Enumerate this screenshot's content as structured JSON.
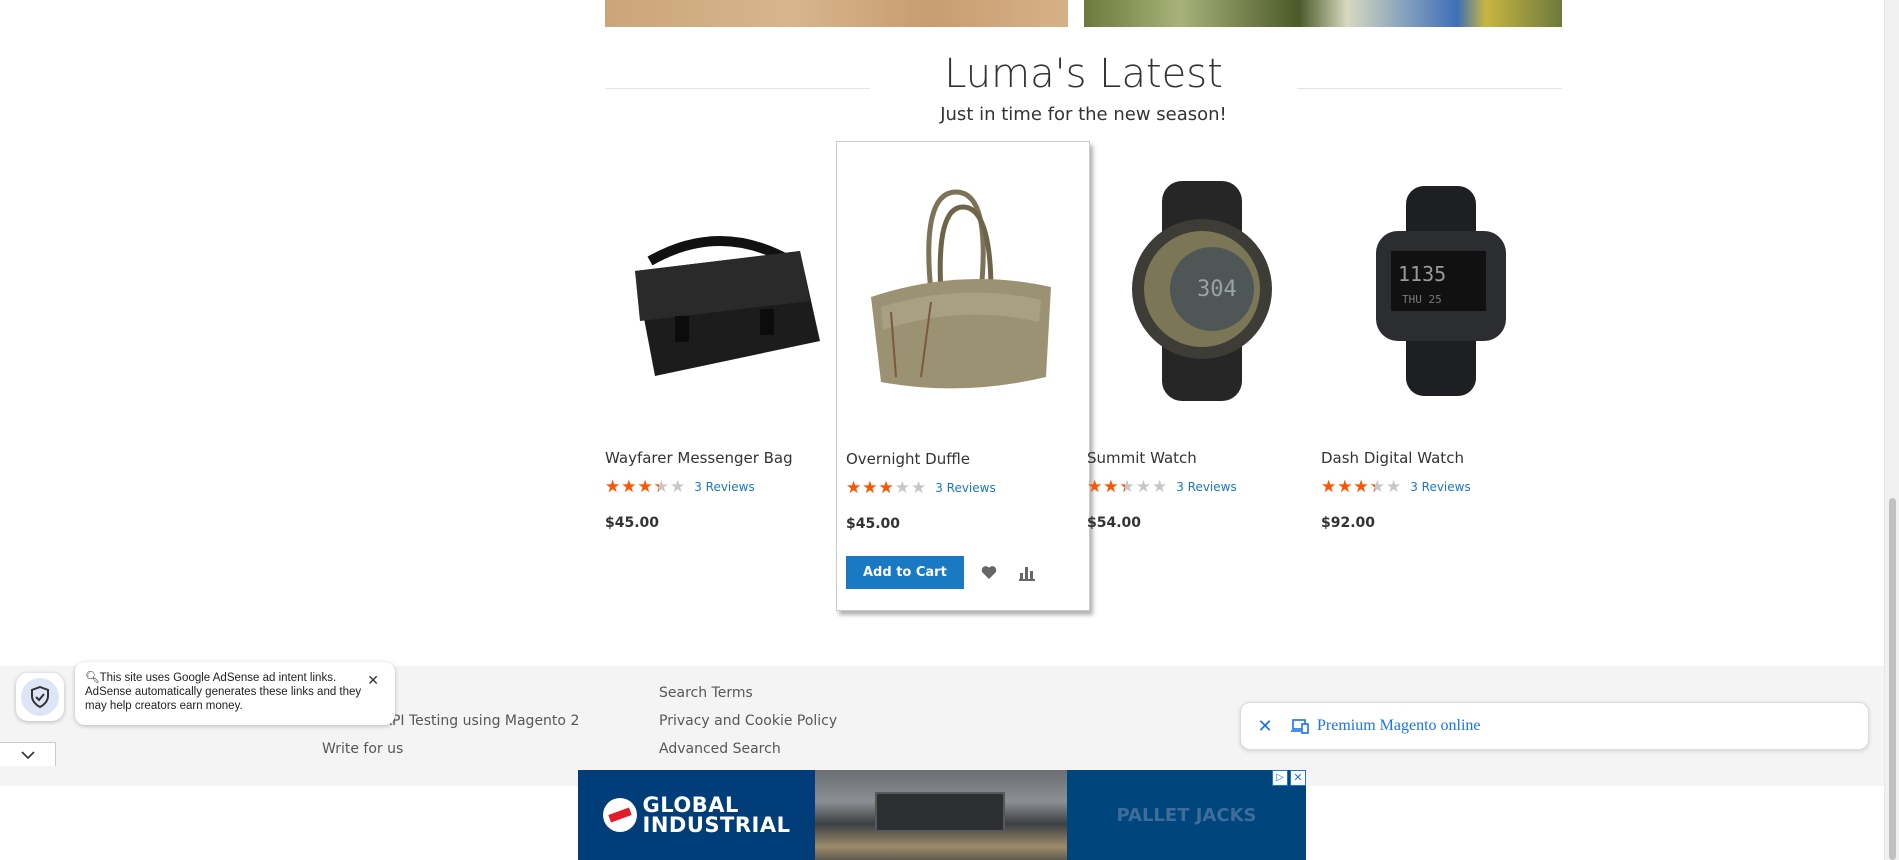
{
  "section": {
    "title": "Luma's Latest",
    "subtitle": "Just in time for the new season!"
  },
  "products": [
    {
      "name": "Wayfarer Messenger Bag",
      "rating_pct": 67,
      "reviews": "3 Reviews",
      "price": "$45.00",
      "image_icon": "messenger-bag-image"
    },
    {
      "name": "Overnight Duffle",
      "rating_pct": 60,
      "reviews": "3 Reviews",
      "price": "$45.00",
      "image_icon": "duffle-bag-image"
    },
    {
      "name": "Summit Watch",
      "rating_pct": 47,
      "reviews": "3 Reviews",
      "price": "$54.00",
      "image_icon": "sport-watch-image"
    },
    {
      "name": "Dash Digital Watch",
      "rating_pct": 67,
      "reviews": "3 Reviews",
      "price": "$92.00",
      "image_icon": "digital-watch-image"
    }
  ],
  "hover_actions": {
    "add_to_cart": "Add to Cart",
    "wishlist_icon": "heart-icon",
    "compare_icon": "bar-chart-icon"
  },
  "footer": {
    "col1": [
      "Practice API Testing using Magento 2",
      "Write for us"
    ],
    "col2": [
      "Search Terms",
      "Privacy and Cookie Policy",
      "Advanced Search"
    ]
  },
  "adsense_notice": {
    "text": "This site uses Google AdSense ad intent links. AdSense automatically generates these links and they may help creators earn money."
  },
  "ad_chip": {
    "label": "Premium Magento online"
  },
  "ad_banner": {
    "brand_line1": "GLOBAL",
    "brand_line2": "INDUSTRIAL",
    "right_text": "PALLET JACKS"
  },
  "colors": {
    "accent": "#1979c3",
    "star": "#ff5501",
    "ad_blue": "#003d79"
  }
}
